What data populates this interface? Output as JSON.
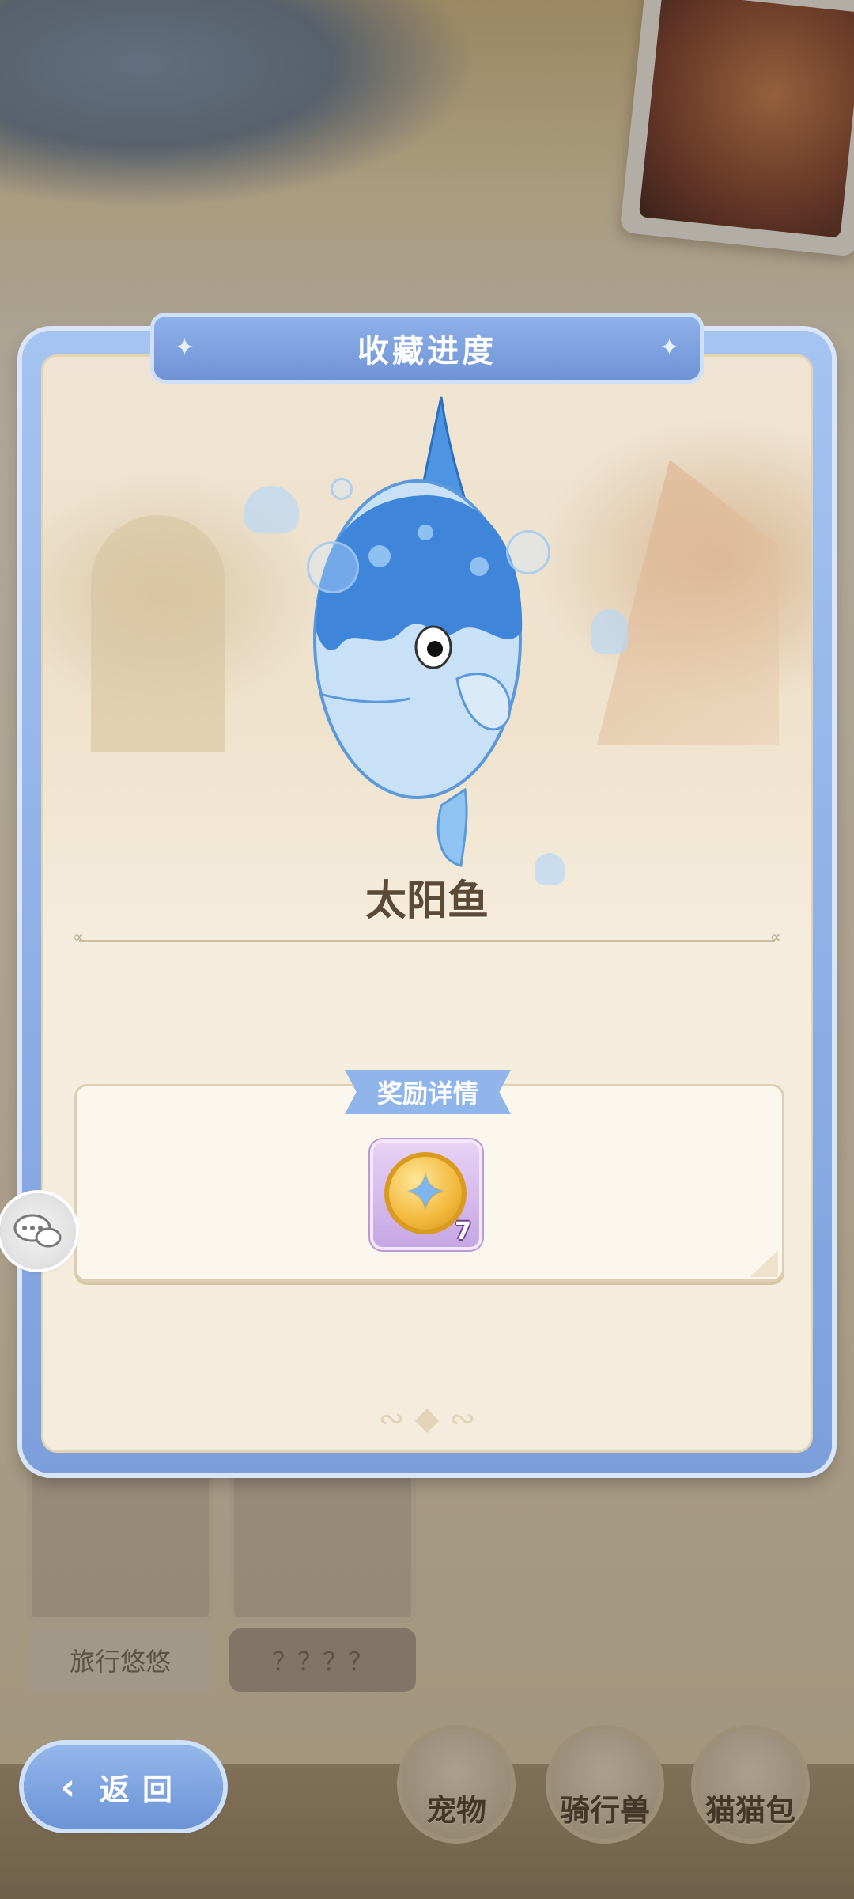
{
  "dialog": {
    "title": "收藏进度",
    "creature_name": "太阳鱼",
    "reward_section_label": "奖励详情",
    "reward_item": {
      "icon": "star-coin-icon",
      "count": "7",
      "rarity_color": "#c6a6e3"
    }
  },
  "background": {
    "cards": [
      {
        "label": "旅行悠悠"
      },
      {
        "label": "？？？？"
      }
    ]
  },
  "bottom_nav": {
    "back_label": "返回",
    "items": [
      {
        "label": "宠物"
      },
      {
        "label": "骑行兽"
      },
      {
        "label": "猫猫包"
      }
    ]
  },
  "colors": {
    "accent_blue": "#7c9fdc",
    "panel_cream": "#f4ecdd",
    "title_text": "#ffffff",
    "name_text": "#5a4a36"
  }
}
